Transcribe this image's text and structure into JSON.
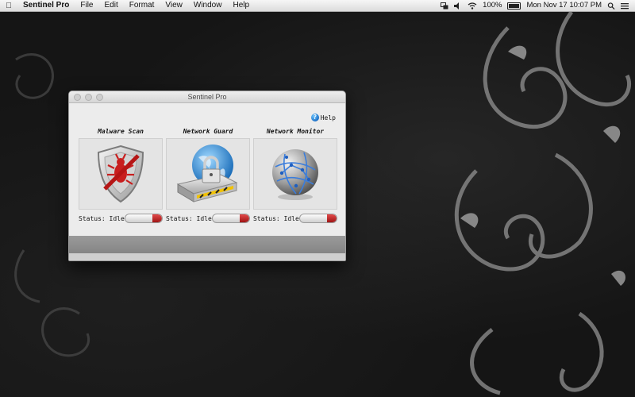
{
  "menubar": {
    "apple_icon": "apple-icon",
    "app_name": "Sentinel Pro",
    "items": [
      "File",
      "Edit",
      "Format",
      "View",
      "Window",
      "Help"
    ],
    "battery_percent": "100%",
    "datetime": "Mon Nov 17  10:07 PM"
  },
  "window": {
    "title": "Sentinel Pro",
    "help_label": "Help",
    "panels": [
      {
        "label": "Malware Scan",
        "status": "Status: Idle",
        "icon": "shield-bug-icon"
      },
      {
        "label": "Network Guard",
        "status": "Status: Idle",
        "icon": "globe-lock-icon"
      },
      {
        "label": "Network Monitor",
        "status": "Status: Idle",
        "icon": "network-globe-icon"
      }
    ]
  },
  "colors": {
    "toggle_off": "#b81d1d",
    "help_blue": "#1b6fc6",
    "desktop_bg": "#151515"
  }
}
